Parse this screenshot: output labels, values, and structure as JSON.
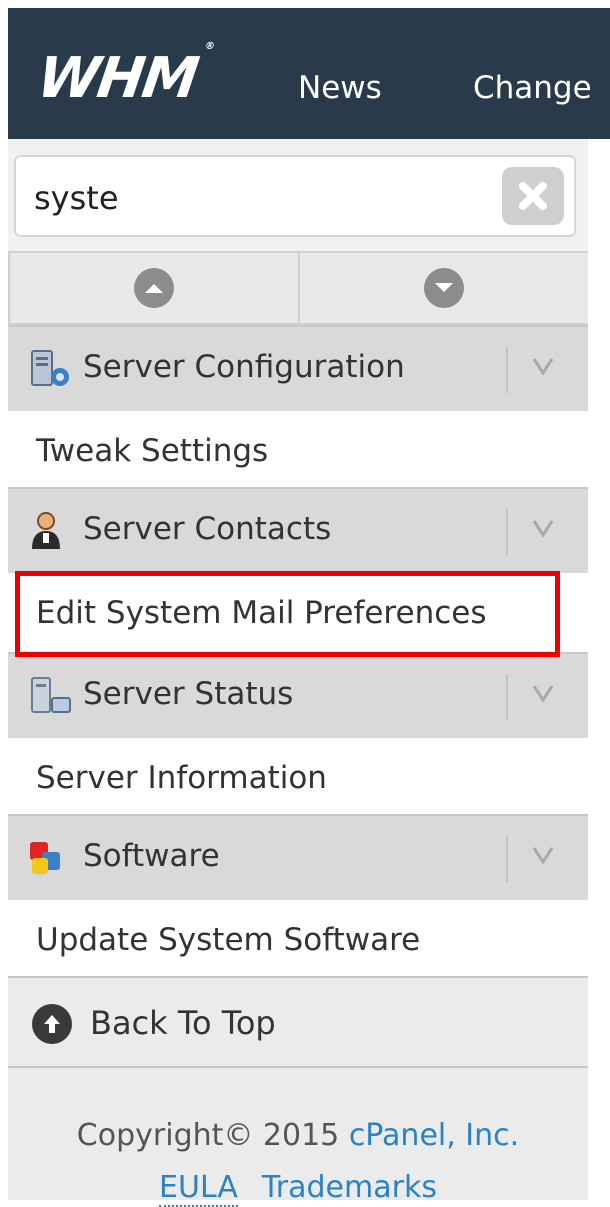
{
  "header": {
    "logo": "WHM",
    "logo_mark": "®",
    "nav": [
      "News",
      "Change"
    ]
  },
  "search": {
    "value": "syste"
  },
  "categories": [
    {
      "label": "Server Configuration",
      "icon": "server-config-icon",
      "item": "Tweak Settings"
    },
    {
      "label": "Server Contacts",
      "icon": "contacts-icon",
      "item": "Edit System Mail Preferences"
    },
    {
      "label": "Server Status",
      "icon": "server-status-icon",
      "item": "Server Information"
    },
    {
      "label": "Software",
      "icon": "software-icon",
      "item": "Update System Software"
    }
  ],
  "back_to_top": "Back To Top",
  "footer": {
    "copyright": "Copyright© 2015 ",
    "company": "cPanel, Inc.",
    "eula": "EULA",
    "trademarks": "Trademarks"
  },
  "colors": {
    "topbar": "#293a4a",
    "highlight": "#ee0000",
    "link": "#2a83c9"
  }
}
